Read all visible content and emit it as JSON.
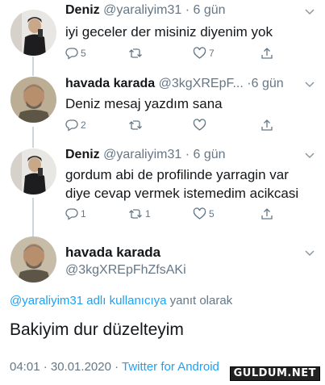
{
  "tweets": [
    {
      "name": "Deniz",
      "handle": "@yaraliyim31",
      "time": "· 6 gün",
      "text": "iyi geceler der misiniz diyenim yok",
      "replies": "5",
      "retweets": "",
      "likes": "7"
    },
    {
      "name": "havada karada",
      "handle": "@3kgXREpF...",
      "time": "·6 gün",
      "text": "Deniz mesaj yazdım sana",
      "replies": "2",
      "retweets": "",
      "likes": ""
    },
    {
      "name": "Deniz",
      "handle": "@yaraliyim31",
      "time": "· 6 gün",
      "text": "gordum abi de profilinde yarragin var diye cevap vermek istemedim acikcasi",
      "replies": "1",
      "retweets": "1",
      "likes": "5"
    }
  ],
  "main": {
    "name": "havada karada",
    "handle": "@3kgXREpFhZfsAKi",
    "reply_link": "@yaraliyim31 adlı kullanıcıya",
    "reply_suffix": " yanıt olarak",
    "text": "Bakiyim dur düzelteyim",
    "timestamp": "04:01 · 30.01.2020 · ",
    "source": "Twitter for Android"
  },
  "watermark": "GULDUM.NET",
  "icons": {
    "reply": "reply-icon",
    "retweet": "retweet-icon",
    "like": "heart-icon",
    "share": "share-icon",
    "more": "chevron-down-icon"
  },
  "colors": {
    "text": "#14171a",
    "secondary": "#657786",
    "link": "#1da1f2",
    "thread_line": "#ccd6dd"
  }
}
